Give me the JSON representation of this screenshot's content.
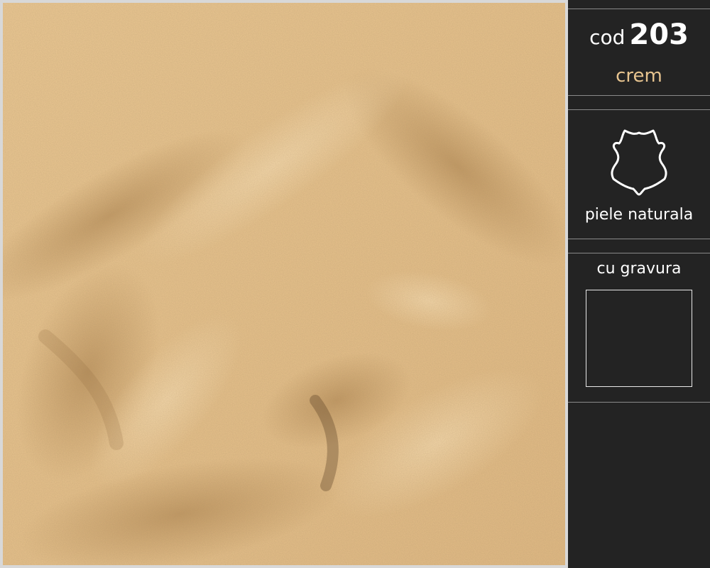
{
  "product": {
    "code_prefix": "cod",
    "code_number": "203",
    "color_name": "crem",
    "material_label": "piele naturala",
    "engraving_label": "cu gravura"
  },
  "icons": {
    "material": "leather-hide-icon"
  },
  "colors": {
    "leather": "#e6c290",
    "sidebar_background": "#232323",
    "color_name_text": "#e7c48f",
    "text": "#ffffff",
    "divider": "#8a8a8a",
    "frame": "#d8d8d8"
  }
}
